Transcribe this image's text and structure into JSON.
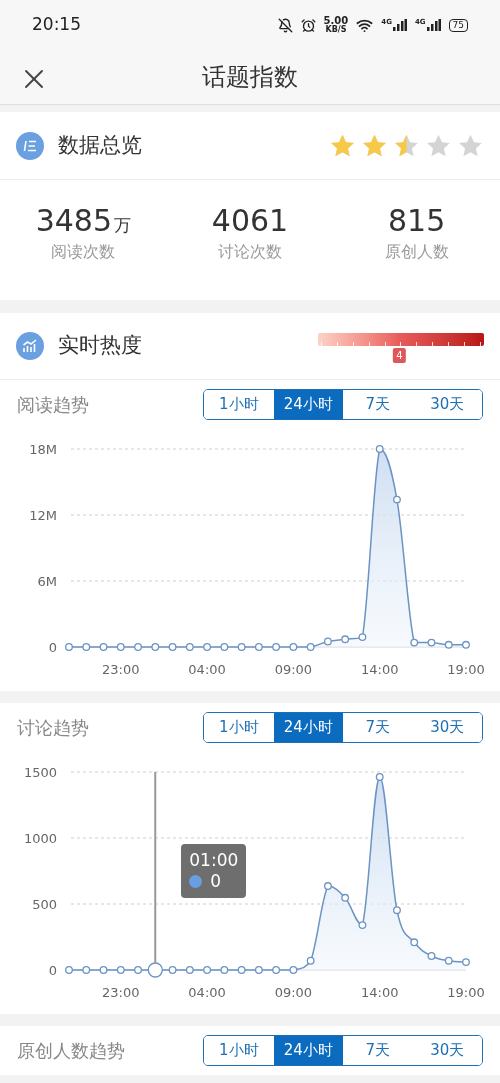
{
  "status_bar": {
    "time": "20:15",
    "speed": "5.00",
    "speed_unit": "KB/S",
    "networks": [
      "4G",
      "4G"
    ],
    "battery": "75"
  },
  "header": {
    "title": "话题指数"
  },
  "overview": {
    "title": "数据总览",
    "stars": 2.5,
    "stats": [
      {
        "value": "3485",
        "unit": "万",
        "label": "阅读次数"
      },
      {
        "value": "4061",
        "label": "讨论次数"
      },
      {
        "value": "815",
        "label": "原创人数"
      }
    ]
  },
  "heat": {
    "title": "实时热度",
    "level": 0.49,
    "marker": "4"
  },
  "trends": [
    {
      "title": "阅读趋势",
      "tabs": [
        {
          "label": "1小时",
          "selected": false
        },
        {
          "label": "24小时",
          "selected": true
        },
        {
          "label": "7天",
          "selected": false
        },
        {
          "label": "30天",
          "selected": false
        }
      ],
      "chart_data": {
        "type": "area",
        "categories": [
          null,
          null,
          null,
          "23:00",
          null,
          null,
          null,
          null,
          "04:00",
          null,
          null,
          null,
          null,
          "09:00",
          null,
          null,
          null,
          null,
          "14:00",
          null,
          null,
          null,
          null,
          "19:00"
        ],
        "values": [
          0,
          0,
          0,
          0,
          0,
          0,
          0,
          0,
          0,
          0,
          0,
          0,
          0,
          0,
          0,
          0.5,
          0.7,
          0.9,
          18,
          13.4,
          0.4,
          0.4,
          0.2,
          0.2
        ],
        "ylim": [
          0,
          18
        ],
        "yticks": [
          {
            "value": 0,
            "label": "0"
          },
          {
            "value": 6,
            "label": "6M"
          },
          {
            "value": 12,
            "label": "12M"
          },
          {
            "value": 18,
            "label": "18M"
          }
        ]
      }
    },
    {
      "title": "讨论趋势",
      "tabs": [
        {
          "label": "1小时",
          "selected": false
        },
        {
          "label": "24小时",
          "selected": true
        },
        {
          "label": "7天",
          "selected": false
        },
        {
          "label": "30天",
          "selected": false
        }
      ],
      "chart_data": {
        "type": "area",
        "categories": [
          null,
          null,
          null,
          "23:00",
          null,
          null,
          null,
          null,
          "04:00",
          null,
          null,
          null,
          null,
          "09:00",
          null,
          null,
          null,
          null,
          "14:00",
          null,
          null,
          null,
          null,
          "19:00"
        ],
        "values": [
          0,
          0,
          0,
          0,
          0,
          0,
          0,
          0,
          0,
          0,
          0,
          0,
          0,
          0,
          70,
          636,
          547,
          340,
          1462,
          453,
          210,
          106,
          70,
          60
        ],
        "ylim": [
          0,
          1500
        ],
        "yticks": [
          {
            "value": 0,
            "label": "0"
          },
          {
            "value": 500,
            "label": "500"
          },
          {
            "value": 1000,
            "label": "1000"
          },
          {
            "value": 1500,
            "label": "1500"
          }
        ]
      },
      "tooltip": {
        "time": "01:00",
        "value": "0"
      }
    },
    {
      "title": "原创人数趋势",
      "tabs": [
        {
          "label": "1小时",
          "selected": false
        },
        {
          "label": "24小时",
          "selected": true
        },
        {
          "label": "7天",
          "selected": false
        },
        {
          "label": "30天",
          "selected": false
        }
      ]
    }
  ]
}
